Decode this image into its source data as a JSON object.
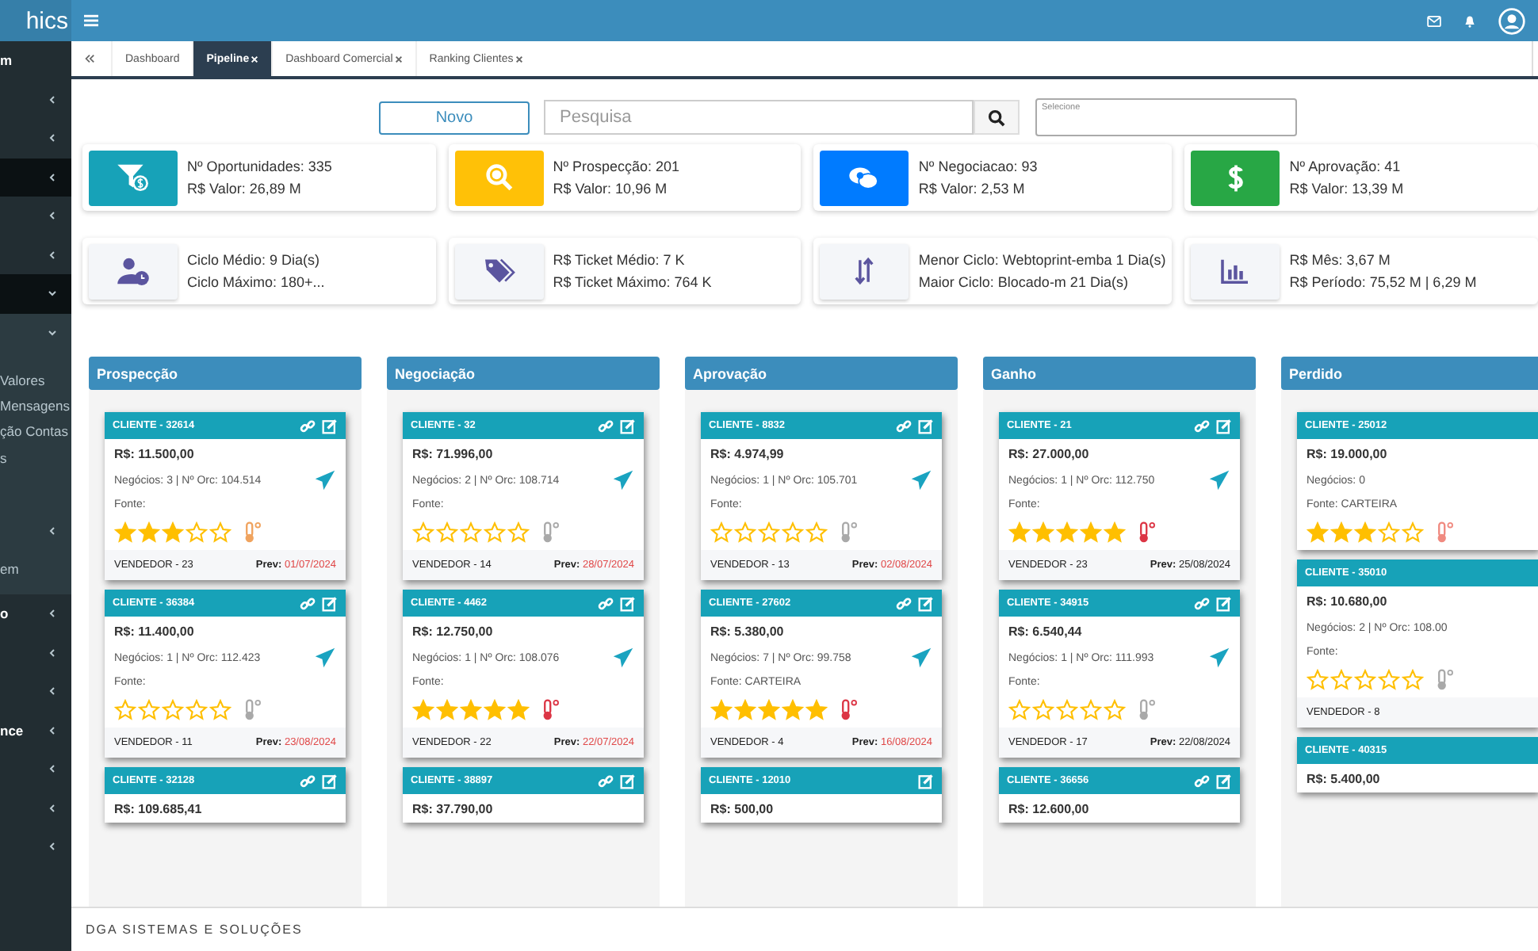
{
  "brand": "hics",
  "sidebar": {
    "items": [
      {
        "label": "m"
      },
      {
        "expanded": false,
        "selected": false
      },
      {
        "expanded": false,
        "selected": false
      },
      {
        "expanded": false,
        "selected": true
      },
      {
        "expanded": false,
        "selected": false
      },
      {
        "expanded": false,
        "selected": false
      },
      {
        "expanded": true,
        "selected": true,
        "children": [
          {
            "expanded": true,
            "children": [
              {
                "label": "Valores"
              },
              {
                "label": "Mensagens"
              },
              {
                "label": "ção Contas"
              },
              {
                "label": "s"
              }
            ]
          },
          {
            "expanded": false
          },
          {
            "label": "em"
          }
        ]
      },
      {
        "label": "o",
        "expanded": false,
        "selected": false
      },
      {
        "expanded": false,
        "selected": false
      },
      {
        "expanded": false,
        "selected": false
      },
      {
        "label": "nce",
        "expanded": false,
        "selected": false
      },
      {
        "expanded": false,
        "selected": false
      },
      {
        "expanded": false,
        "selected": false
      },
      {
        "expanded": false,
        "selected": false
      }
    ]
  },
  "tabs": [
    {
      "label": "Dashboard",
      "selected": false,
      "closable": false
    },
    {
      "label": "Pipeline",
      "selected": true,
      "closable": true
    },
    {
      "label": "Dashboard Comercial",
      "selected": false,
      "closable": true
    },
    {
      "label": "Ranking Clientes",
      "selected": false,
      "closable": true
    }
  ],
  "toolbar": {
    "new_button": "Novo",
    "search": {
      "placeholder": "Pesquisa"
    },
    "select": {
      "placeholder": "Selecione"
    }
  },
  "stats": [
    {
      "color": "#17a2b8",
      "lines": [
        "Nº Oportunidades: 335",
        "R$ Valor: 26,89 M"
      ]
    },
    {
      "color": "#ffc107",
      "lines": [
        "Nº Prospecção: 201",
        "R$ Valor: 10,96 M"
      ]
    },
    {
      "color": "#007bff",
      "lines": [
        "Nº Negociacao: 93",
        "R$ Valor: 2,53 M"
      ]
    },
    {
      "color": "#28a745",
      "lines": [
        "Nº Aprovação: 41",
        "R$ Valor: 13,39 M"
      ]
    },
    {
      "lines": [
        "Ciclo Médio: 9 Dia(s)",
        "Ciclo Máximo: 180+..."
      ]
    },
    {
      "lines": [
        "R$ Ticket Médio: 7 K",
        "R$ Ticket Máximo: 764 K"
      ]
    },
    {
      "lines": [
        "Menor Ciclo: Webtoprint-emba 1 Dia(s)",
        "Maior Ciclo: Blocado-m 21 Dia(s)"
      ]
    },
    {
      "lines": [
        "R$ Mês: 3,67 M",
        "R$ Período: 75,52 M | 6,29 M"
      ]
    }
  ],
  "columns": [
    {
      "title": "Prospecção",
      "cards": [
        {
          "client": "CLIENTE - 32614",
          "link": true,
          "edit": true,
          "value": "R$: 11.500,00",
          "deals": "Negócios: 3 | Nº Orc: 104.514",
          "send": true,
          "source": "Fonte:",
          "stars": 3,
          "color": "#f0a35e",
          "seller": "VENDEDOR - 23",
          "prev_label": "Prev:",
          "prev": "01/07/2024",
          "overdue": true
        },
        {
          "client": "CLIENTE - 36384",
          "link": true,
          "edit": true,
          "value": "R$: 11.400,00",
          "deals": "Negócios: 1 | Nº Orc: 112.423",
          "send": true,
          "source": "Fonte:",
          "stars": 0,
          "color": "#a9a9a9",
          "seller": "VENDEDOR - 11",
          "prev_label": "Prev:",
          "prev": "23/08/2024",
          "overdue": true
        },
        {
          "client": "CLIENTE - 32128",
          "link": true,
          "edit": true,
          "value": "R$: 109.685,41"
        }
      ]
    },
    {
      "title": "Negociação",
      "cards": [
        {
          "client": "CLIENTE - 32",
          "link": true,
          "edit": true,
          "value": "R$: 71.996,00",
          "deals": "Negócios: 2 | Nº Orc: 108.714",
          "send": true,
          "source": "Fonte:",
          "stars": 0,
          "color": "#a9a9a9",
          "seller": "VENDEDOR - 14",
          "prev_label": "Prev:",
          "prev": "28/07/2024",
          "overdue": true
        },
        {
          "client": "CLIENTE - 4462",
          "link": true,
          "edit": true,
          "value": "R$: 12.750,00",
          "deals": "Negócios: 1 | Nº Orc: 108.076",
          "send": true,
          "source": "Fonte:",
          "stars": 5,
          "color": "#dc3545",
          "seller": "VENDEDOR - 22",
          "prev_label": "Prev:",
          "prev": "22/07/2024",
          "overdue": true
        },
        {
          "client": "CLIENTE - 38897",
          "link": true,
          "edit": true,
          "value": "R$: 37.790,00"
        }
      ]
    },
    {
      "title": "Aprovação",
      "cards": [
        {
          "client": "CLIENTE - 8832",
          "link": true,
          "edit": true,
          "value": "R$: 4.974,99",
          "deals": "Negócios: 1 | Nº Orc: 105.701",
          "send": true,
          "source": "Fonte:",
          "stars": 0,
          "color": "#a9a9a9",
          "seller": "VENDEDOR - 13",
          "prev_label": "Prev:",
          "prev": "02/08/2024",
          "overdue": true
        },
        {
          "client": "CLIENTE - 27602",
          "link": true,
          "edit": true,
          "value": "R$: 5.380,00",
          "deals": "Negócios: 7 | Nº Orc: 99.758",
          "send": true,
          "source": "Fonte: CARTEIRA",
          "stars": 5,
          "color": "#dc3545",
          "seller": "VENDEDOR - 4",
          "prev_label": "Prev:",
          "prev": "16/08/2024",
          "overdue": true
        },
        {
          "client": "CLIENTE - 12010",
          "link": false,
          "edit": true,
          "value": "R$: 500,00"
        }
      ]
    },
    {
      "title": "Ganho",
      "cards": [
        {
          "client": "CLIENTE - 21",
          "link": true,
          "edit": true,
          "value": "R$: 27.000,00",
          "deals": "Negócios: 1 | Nº Orc: 112.750",
          "send": true,
          "source": "Fonte:",
          "stars": 5,
          "color": "#dc3545",
          "seller": "VENDEDOR - 23",
          "prev_label": "Prev:",
          "prev": "25/08/2024",
          "overdue": false
        },
        {
          "client": "CLIENTE - 34915",
          "link": true,
          "edit": true,
          "value": "R$: 6.540,44",
          "deals": "Negócios: 1 | Nº Orc: 111.993",
          "send": true,
          "source": "Fonte:",
          "stars": 0,
          "color": "#a9a9a9",
          "seller": "VENDEDOR - 17",
          "prev_label": "Prev:",
          "prev": "22/08/2024",
          "overdue": false
        },
        {
          "client": "CLIENTE - 36656",
          "link": true,
          "edit": true,
          "value": "R$: 12.600,00"
        }
      ]
    },
    {
      "title": "Perdido",
      "cards": [
        {
          "client": "CLIENTE - 25012",
          "link": false,
          "edit": false,
          "value": "R$: 19.000,00",
          "deals": "Negócios: 0",
          "send": false,
          "source": "Fonte: CARTEIRA",
          "stars": 3,
          "color": "#f08a80"
        },
        {
          "client": "CLIENTE - 35010",
          "link": false,
          "edit": false,
          "value": "R$: 10.680,00",
          "deals": "Negócios: 2 | Nº Orc: 108.00",
          "send": false,
          "source": "Fonte:",
          "stars": 0,
          "color": "#a9a9a9",
          "seller": "VENDEDOR - 8"
        },
        {
          "client": "CLIENTE - 40315",
          "link": false,
          "edit": false,
          "value": "R$: 5.400,00"
        }
      ]
    }
  ],
  "footer": "DGA SISTEMAS E SOLUÇÕES"
}
